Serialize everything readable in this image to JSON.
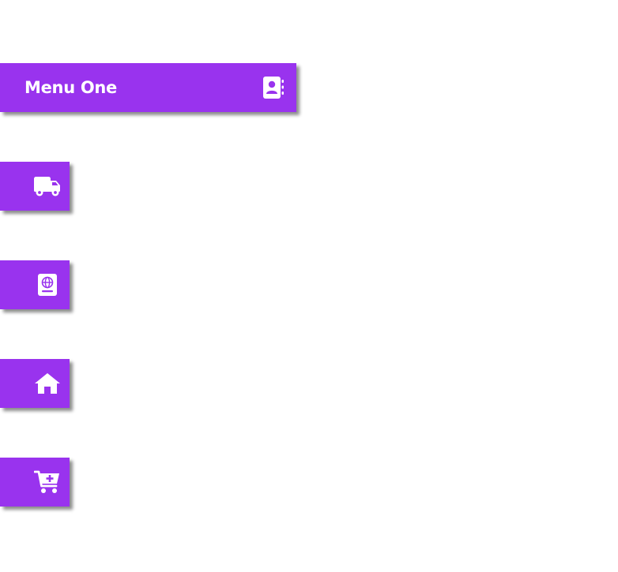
{
  "menu": {
    "items": [
      {
        "label": "Menu One",
        "icon": "address-book-icon",
        "expanded": true
      },
      {
        "label": "",
        "icon": "truck-icon",
        "expanded": false
      },
      {
        "label": "",
        "icon": "passport-icon",
        "expanded": false
      },
      {
        "label": "",
        "icon": "home-icon",
        "expanded": false
      },
      {
        "label": "",
        "icon": "cart-plus-icon",
        "expanded": false
      }
    ]
  },
  "colors": {
    "accent": "#9933ee",
    "icon": "#ffffff",
    "background": "#ffffff"
  }
}
